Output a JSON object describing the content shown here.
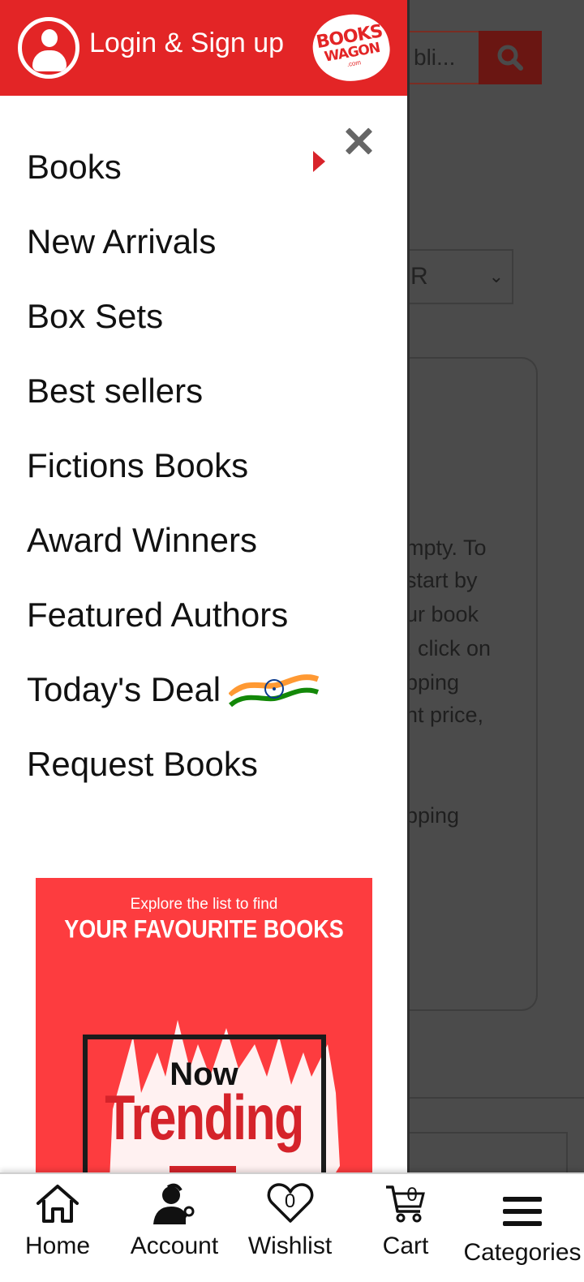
{
  "header": {
    "login_label": "Login & Sign up",
    "logo_line1": "BOOKS",
    "logo_line2": "WAGON",
    "logo_line3": ".com"
  },
  "background": {
    "search_placeholder": "bli...",
    "select_value": "R",
    "text_lines": [
      "mpty. To",
      " start by",
      "ur book",
      ", click on",
      "pping",
      "nt price,",
      "pping"
    ]
  },
  "menu": {
    "items": [
      {
        "label": "Books"
      },
      {
        "label": "New Arrivals"
      },
      {
        "label": "Box Sets"
      },
      {
        "label": "Best sellers"
      },
      {
        "label": "Fictions Books"
      },
      {
        "label": "Award Winners"
      },
      {
        "label": "Featured Authors"
      },
      {
        "label": "Today's Deal"
      },
      {
        "label": "Request Books"
      }
    ]
  },
  "banner": {
    "line1": "Explore the list to find",
    "line2": "YOUR FAVOURITE BOOKS",
    "now": "Now",
    "trending": "Trending"
  },
  "bottom_nav": {
    "home": "Home",
    "account": "Account",
    "wishlist": "Wishlist",
    "wishlist_count": "0",
    "cart": "Cart",
    "cart_count": "0",
    "categories": "Categories"
  },
  "colors": {
    "brand_red": "#e32526",
    "overlay": "#4b4b4b"
  }
}
